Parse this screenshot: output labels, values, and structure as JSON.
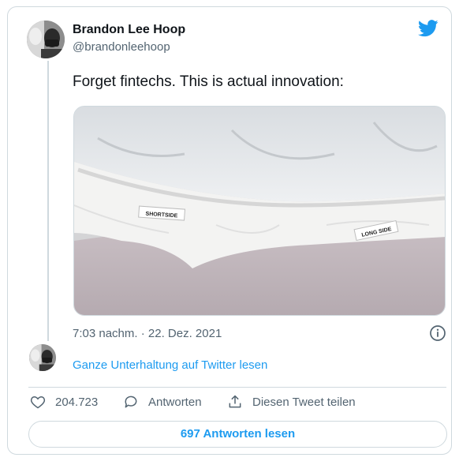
{
  "tweet": {
    "author_name": "Brandon Lee Hoop",
    "author_handle": "@brandonleehoop",
    "text": "Forget fintechs. This is actual innovation:",
    "timestamp": "7:03 nachm. · 22. Dez. 2021",
    "media": {
      "label_short": "SHORTSIDE",
      "label_long": "LONG SIDE"
    }
  },
  "thread": {
    "read_full_conversation": "Ganze Unterhaltung auf Twitter lesen"
  },
  "actions": {
    "likes": "204.723",
    "reply_label": "Antworten",
    "share_label": "Diesen Tweet teilen",
    "read_replies": "697 Antworten lesen"
  },
  "colors": {
    "accent": "#1d9bf0",
    "muted": "#536471",
    "border": "#cfd9de"
  },
  "icons": [
    "twitter-bird-icon",
    "info-icon",
    "heart-icon",
    "reply-icon",
    "share-icon"
  ]
}
